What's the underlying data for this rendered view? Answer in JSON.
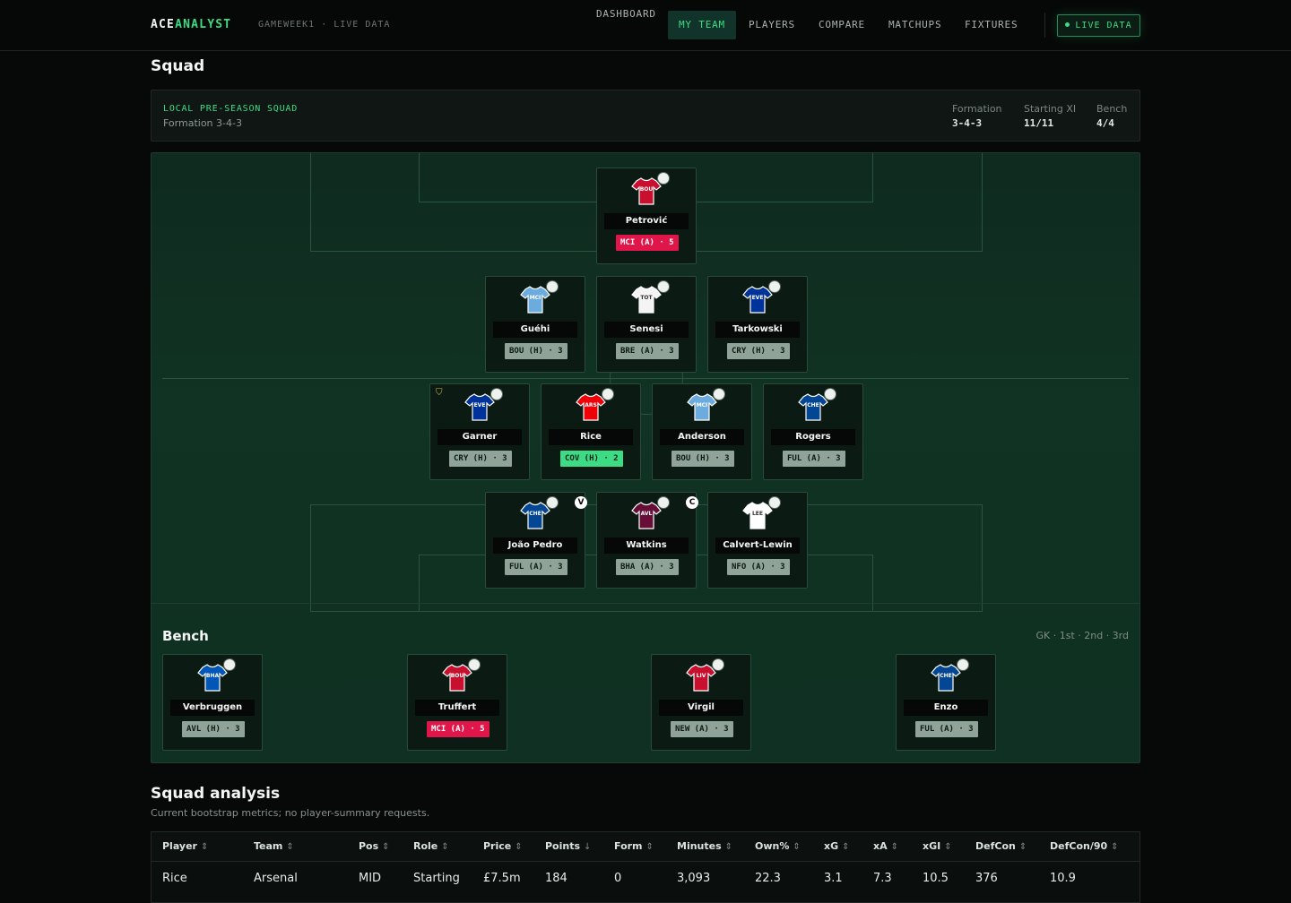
{
  "header": {
    "brand_main": "ACE",
    "brand_accent": "ANALYST",
    "subtitle": "GAMEWEEK1 · LIVE DATA",
    "nav": [
      "DASHBOARD",
      "MY TEAM",
      "PLAYERS",
      "COMPARE",
      "MATCHUPS",
      "FIXTURES"
    ],
    "active_nav": "MY TEAM",
    "live_label": "LIVE DATA"
  },
  "page_title": "Squad",
  "squad_panel": {
    "kicker": "LOCAL PRE-SEASON SQUAD",
    "description": "Formation 3-4-3",
    "stats": [
      {
        "label": "Formation",
        "value": "3-4-3"
      },
      {
        "label": "Starting XI",
        "value": "11/11"
      },
      {
        "label": "Bench",
        "value": "4/4"
      }
    ]
  },
  "pitch": {
    "goalkeeper": [
      {
        "name": "Petrović",
        "team": "BOU",
        "kit": "#c8102e",
        "fixture": "MCI (A) · 5",
        "difficulty": "hard"
      }
    ],
    "defenders": [
      {
        "name": "Guéhi",
        "team": "MCI",
        "kit": "#6cabdd",
        "fixture": "BOU (H) · 3",
        "difficulty": "neutral"
      },
      {
        "name": "Senesi",
        "team": "TOT",
        "kit": "#f4f4f4",
        "fixture": "BRE (A) · 3",
        "difficulty": "neutral"
      },
      {
        "name": "Tarkowski",
        "team": "EVE",
        "kit": "#003399",
        "fixture": "CRY (H) · 3",
        "difficulty": "neutral"
      }
    ],
    "midfielders": [
      {
        "name": "Garner",
        "team": "EVE",
        "kit": "#003399",
        "fixture": "CRY (H) · 3",
        "difficulty": "neutral"
      },
      {
        "name": "Rice",
        "team": "ARS",
        "kit": "#ef0107",
        "fixture": "COV (H) · 2",
        "difficulty": "easy"
      },
      {
        "name": "Anderson",
        "team": "MCI",
        "kit": "#6cabdd",
        "fixture": "BOU (H) · 3",
        "difficulty": "neutral"
      },
      {
        "name": "Rogers",
        "team": "CHE",
        "kit": "#034694",
        "fixture": "FUL (A) · 3",
        "difficulty": "neutral"
      }
    ],
    "forwards": [
      {
        "name": "João Pedro",
        "team": "CHE",
        "kit": "#034694",
        "fixture": "FUL (A) · 3",
        "difficulty": "neutral",
        "armband": "V"
      },
      {
        "name": "Watkins",
        "team": "AVL",
        "kit": "#670e36",
        "fixture": "BHA (A) · 3",
        "difficulty": "neutral",
        "armband": "C"
      },
      {
        "name": "Calvert-Lewin",
        "team": "LEE",
        "kit": "#ffffff",
        "fixture": "NFO (A) · 3",
        "difficulty": "neutral"
      }
    ],
    "bench_title": "Bench",
    "bench_order": "GK · 1st · 2nd · 3rd",
    "bench": [
      {
        "name": "Verbruggen",
        "team": "BHA",
        "kit": "#0057b8",
        "fixture": "AVL (H) · 3",
        "difficulty": "neutral"
      },
      {
        "name": "Truffert",
        "team": "BOU",
        "kit": "#c8102e",
        "fixture": "MCI (A) · 5",
        "difficulty": "hard"
      },
      {
        "name": "Virgil",
        "team": "LIV",
        "kit": "#c8102e",
        "fixture": "NEW (A) · 3",
        "difficulty": "neutral"
      },
      {
        "name": "Enzo",
        "team": "CHE",
        "kit": "#034694",
        "fixture": "FUL (A) · 3",
        "difficulty": "neutral"
      }
    ]
  },
  "analysis": {
    "title": "Squad analysis",
    "subtitle": "Current bootstrap metrics; no player-summary requests.",
    "columns": [
      "Player",
      "Team",
      "Pos",
      "Role",
      "Price",
      "Points",
      "Form",
      "Minutes",
      "Own%",
      "xG",
      "xA",
      "xGI",
      "DefCon",
      "DefCon/90"
    ],
    "sorted_column": "Points",
    "rows": [
      [
        "Rice",
        "Arsenal",
        "MID",
        "Starting",
        "£7.5m",
        "184",
        "0",
        "3,093",
        "22.3",
        "3.1",
        "7.3",
        "10.5",
        "376",
        "10.9"
      ]
    ]
  }
}
